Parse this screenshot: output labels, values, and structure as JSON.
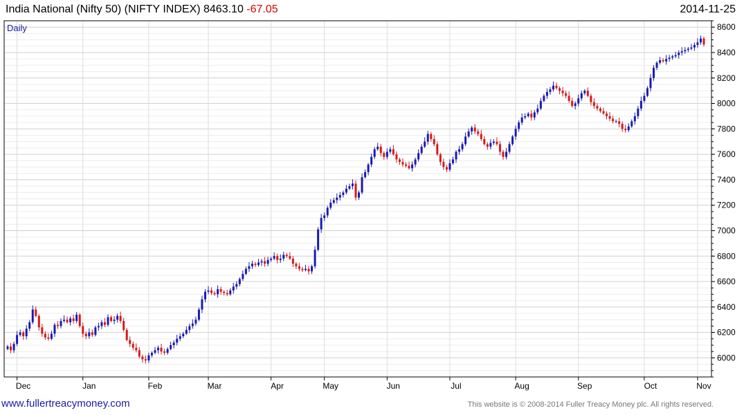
{
  "header": {
    "title": "India National (Nifty 50) (NIFTY INDEX) 8463.10",
    "change": "-67.05",
    "date": "2014-11-25"
  },
  "footer": {
    "site": "www.fullertreacymoney.com",
    "copyright": "This website is © 2008-2014 Fuller Treacy Money plc. All rights reserved."
  },
  "colors": {
    "up": "#1a1ab4",
    "down": "#d41a1a",
    "grid": "#dcdcdc",
    "axis": "#000000"
  },
  "chart_data": {
    "type": "candlestick",
    "period_label": "Daily",
    "ylim": [
      5850,
      8650
    ],
    "yticks": [
      6000,
      6200,
      6400,
      6600,
      6800,
      7000,
      7200,
      7400,
      7600,
      7800,
      8000,
      8200,
      8400,
      8600
    ],
    "month_labels": [
      {
        "label": "Dec",
        "index": 3
      },
      {
        "label": "Jan",
        "index": 24
      },
      {
        "label": "Feb",
        "index": 45
      },
      {
        "label": "Mar",
        "index": 64
      },
      {
        "label": "Apr",
        "index": 84
      },
      {
        "label": "May",
        "index": 101
      },
      {
        "label": "Jun",
        "index": 121
      },
      {
        "label": "Jul",
        "index": 141
      },
      {
        "label": "Aug",
        "index": 162
      },
      {
        "label": "Sep",
        "index": 182
      },
      {
        "label": "Oct",
        "index": 203
      },
      {
        "label": "Nov",
        "index": 220
      }
    ],
    "closes": [
      6090,
      6060,
      6110,
      6180,
      6200,
      6170,
      6230,
      6280,
      6380,
      6330,
      6240,
      6190,
      6160,
      6150,
      6190,
      6260,
      6250,
      6290,
      6300,
      6280,
      6310,
      6290,
      6340,
      6250,
      6190,
      6170,
      6200,
      6180,
      6240,
      6250,
      6280,
      6260,
      6320,
      6290,
      6300,
      6330,
      6290,
      6220,
      6140,
      6110,
      6080,
      6060,
      6010,
      5990,
      5980,
      6020,
      6040,
      6060,
      6080,
      6050,
      6040,
      6070,
      6100,
      6120,
      6150,
      6170,
      6190,
      6220,
      6250,
      6270,
      6300,
      6380,
      6460,
      6520,
      6530,
      6510,
      6500,
      6540,
      6520,
      6510,
      6500,
      6530,
      6560,
      6580,
      6620,
      6660,
      6700,
      6720,
      6740,
      6730,
      6750,
      6760,
      6740,
      6770,
      6780,
      6800,
      6770,
      6780,
      6810,
      6800,
      6780,
      6740,
      6720,
      6700,
      6690,
      6700,
      6680,
      6720,
      6850,
      7010,
      7100,
      7120,
      7180,
      7220,
      7240,
      7260,
      7280,
      7300,
      7330,
      7350,
      7370,
      7260,
      7300,
      7420,
      7460,
      7520,
      7580,
      7640,
      7660,
      7610,
      7580,
      7620,
      7640,
      7600,
      7560,
      7540,
      7520,
      7510,
      7490,
      7520,
      7560,
      7610,
      7660,
      7700,
      7760,
      7720,
      7680,
      7600,
      7540,
      7500,
      7480,
      7530,
      7560,
      7620,
      7640,
      7680,
      7740,
      7780,
      7810,
      7780,
      7760,
      7720,
      7680,
      7660,
      7690,
      7700,
      7680,
      7620,
      7580,
      7620,
      7680,
      7740,
      7800,
      7850,
      7890,
      7900,
      7920,
      7890,
      7930,
      7960,
      8020,
      8060,
      8090,
      8110,
      8140,
      8120,
      8100,
      8080,
      8060,
      8020,
      7980,
      8000,
      8040,
      8080,
      8100,
      8060,
      8010,
      7980,
      7960,
      7940,
      7920,
      7900,
      7880,
      7860,
      7860,
      7840,
      7800,
      7790,
      7820,
      7860,
      7900,
      7960,
      8020,
      8060,
      8120,
      8200,
      8280,
      8320,
      8340,
      8330,
      8350,
      8360,
      8370,
      8380,
      8400,
      8410,
      8420,
      8430,
      8440,
      8460,
      8480,
      8510,
      8463
    ]
  }
}
